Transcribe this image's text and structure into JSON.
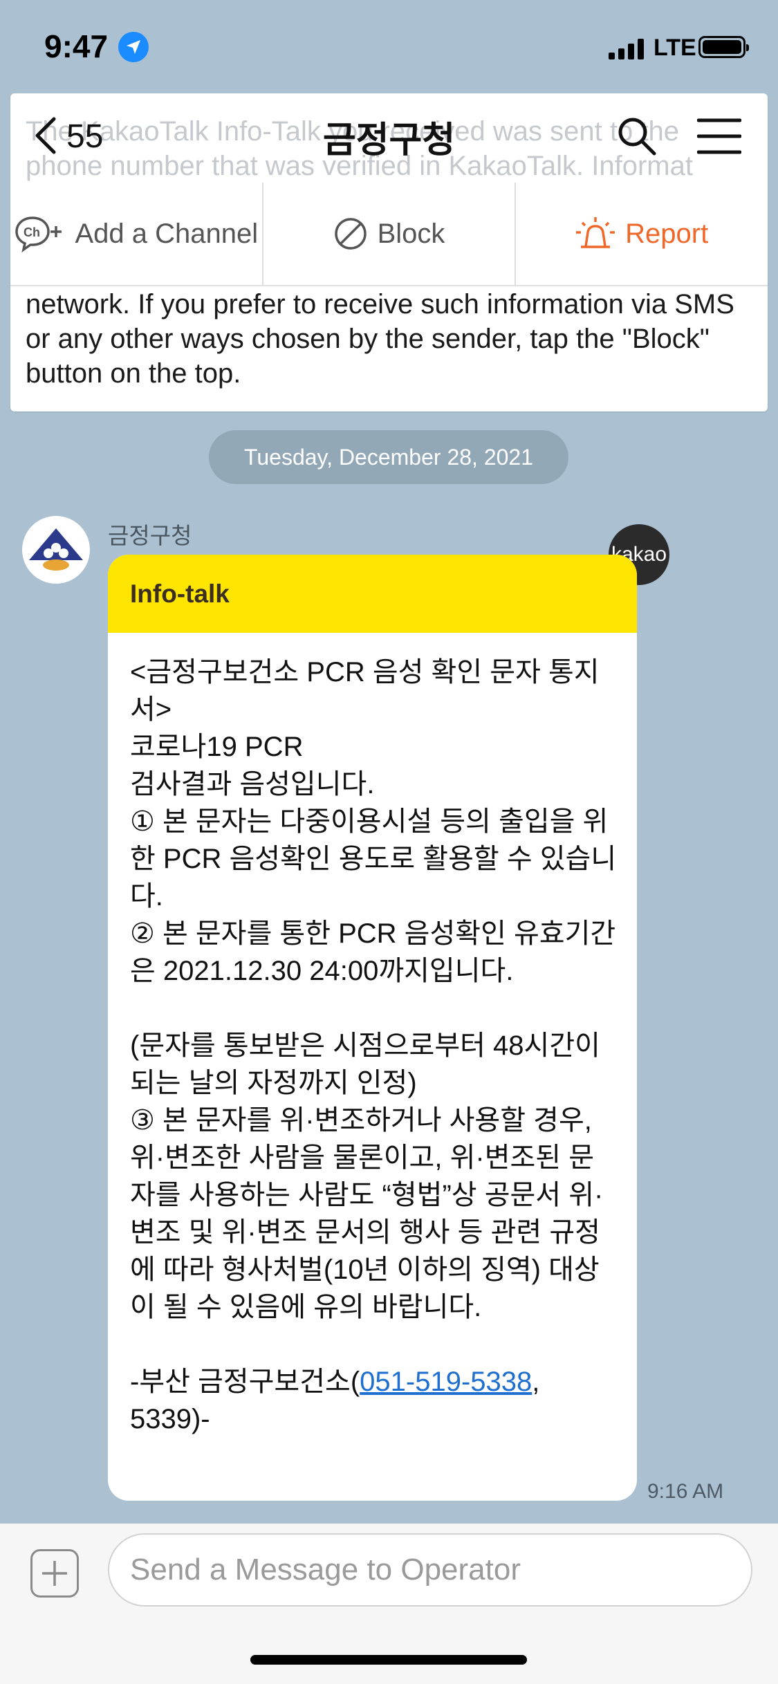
{
  "status": {
    "time": "9:47",
    "network": "LTE"
  },
  "header": {
    "back_count": "55",
    "title": "금정구청"
  },
  "actions": {
    "add_channel": "Add a Channel",
    "block": "Block",
    "report": "Report"
  },
  "notice": {
    "faded_text": "The KakaoTalk Info-Talk you received was sent to the phone number that was verified in KakaoTalk. Informat",
    "text": "network. If you prefer to receive such information via SMS or any other ways chosen by the sender, tap the \"Block\" button on the top."
  },
  "date_divider": "Tuesday, December 28, 2021",
  "message": {
    "sender": "금정구청",
    "badge": "kakao",
    "header": "Info-talk",
    "body": "<금정구보건소 PCR 음성 확인 문자 통지서>\n                      코로나19 PCR\n 검사결과 음성입니다.\n① 본 문자는 다중이용시설 등의 출입을 위한 PCR 음성확인 용도로 활용할 수 있습니다.\n② 본 문자를 통한 PCR 음성확인 유효기간은 2021.12.30 24:00까지입니다.\n\n(문자를 통보받은 시점으로부터 48시간이 되는 날의 자정까지 인정)\n③ 본 문자를 위·변조하거나 사용할 경우, 위·변조한 사람을 물론이고, 위·변조된 문자를 사용하는 사람도 “형법”상 공문서 위·변조 및 위·변조 문서의 행사 등 관련 규정에 따라 형사처벌(10년 이하의 징역) 대상이 될 수 있음에 유의 바랍니다.\n\n-부산 금정구보건소(",
    "phone_link": "051-519-5338",
    "footer_tail": ",\n5339)-",
    "time": "9:16 AM"
  },
  "input": {
    "placeholder": "Send a Message to Operator"
  },
  "colors": {
    "info_header": "#fde500",
    "report": "#f0672a",
    "link": "#1e6fd0",
    "background": "#abc1d1"
  }
}
